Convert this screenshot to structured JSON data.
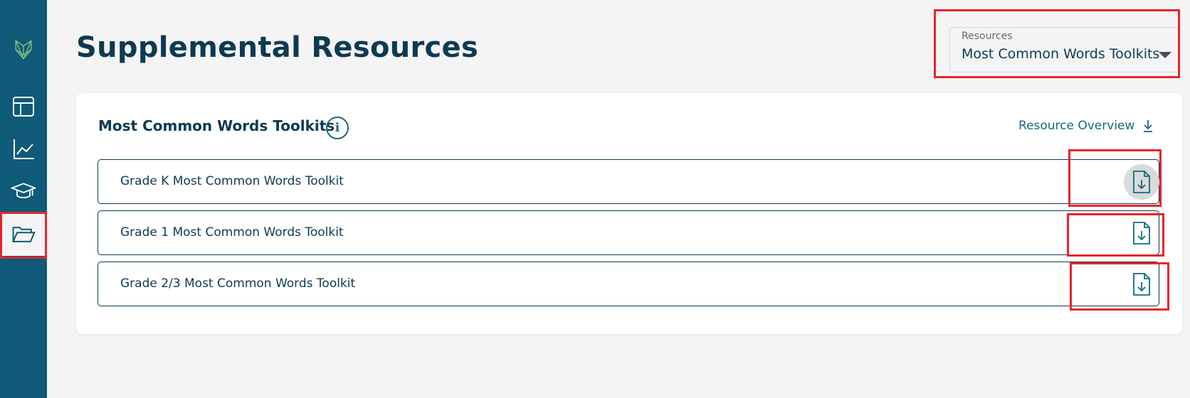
{
  "page": {
    "title": "Supplemental Resources"
  },
  "nav": {
    "items": [
      {
        "name": "logo-icon",
        "active": false
      },
      {
        "name": "dashboard-icon",
        "active": false
      },
      {
        "name": "chart-icon",
        "active": false
      },
      {
        "name": "graduation-cap-icon",
        "active": false
      },
      {
        "name": "folder-icon",
        "active": true
      }
    ]
  },
  "dropdown": {
    "label": "Resources",
    "value": "Most Common Words Toolkits"
  },
  "card": {
    "title": "Most Common Words Toolkits",
    "info_glyph": "i",
    "overview_link": "Resource Overview"
  },
  "resources": [
    {
      "label": "Grade K Most Common Words Toolkit",
      "icon": "file-download-icon"
    },
    {
      "label": "Grade 1 Most Common Words Toolkit",
      "icon": "file-download-icon"
    },
    {
      "label": "Grade 2/3 Most Common Words Toolkit",
      "icon": "file-download-icon"
    }
  ],
  "colors": {
    "sidebar": "#0e5a78",
    "heading": "#0d3a52",
    "accent": "#16697f",
    "highlight": "#e8242b"
  }
}
